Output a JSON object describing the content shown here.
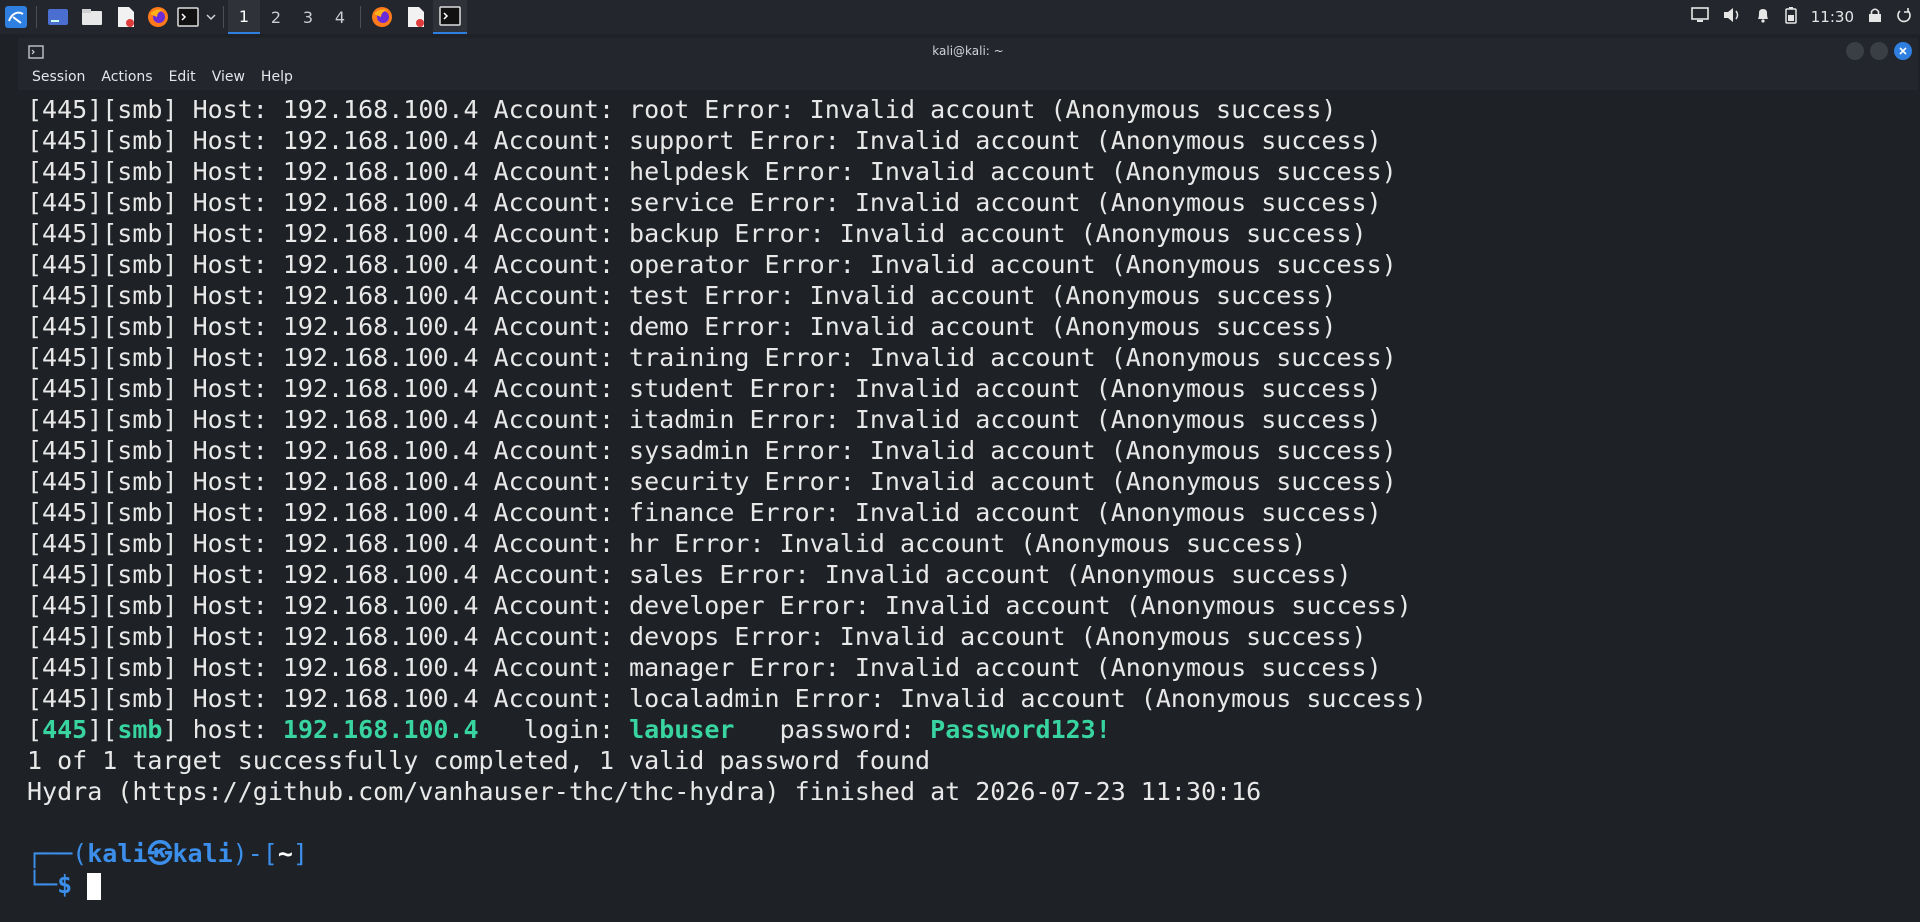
{
  "panel": {
    "workspaces": [
      "1",
      "2",
      "3",
      "4"
    ],
    "active_workspace": "1",
    "clock": "11:30",
    "icons": [
      "kali-menu-icon",
      "desktop-icon",
      "file-manager-icon",
      "text-editor-icon",
      "firefox-icon",
      "terminal-icon",
      "chevron-down-icon",
      "firefox-icon",
      "text-editor-icon",
      "terminal-icon",
      "display-icon",
      "volume-icon",
      "bell-icon",
      "battery-icon",
      "lock-icon",
      "power-icon"
    ]
  },
  "window": {
    "title": "kali@kali: ~",
    "menu": [
      "Session",
      "Actions",
      "Edit",
      "View",
      "Help"
    ]
  },
  "terminal": {
    "account_lines": [
      "[445][smb] Host: 192.168.100.4 Account: root Error: Invalid account (Anonymous success)",
      "[445][smb] Host: 192.168.100.4 Account: support Error: Invalid account (Anonymous success)",
      "[445][smb] Host: 192.168.100.4 Account: helpdesk Error: Invalid account (Anonymous success)",
      "[445][smb] Host: 192.168.100.4 Account: service Error: Invalid account (Anonymous success)",
      "[445][smb] Host: 192.168.100.4 Account: backup Error: Invalid account (Anonymous success)",
      "[445][smb] Host: 192.168.100.4 Account: operator Error: Invalid account (Anonymous success)",
      "[445][smb] Host: 192.168.100.4 Account: test Error: Invalid account (Anonymous success)",
      "[445][smb] Host: 192.168.100.4 Account: demo Error: Invalid account (Anonymous success)",
      "[445][smb] Host: 192.168.100.4 Account: training Error: Invalid account (Anonymous success)",
      "[445][smb] Host: 192.168.100.4 Account: student Error: Invalid account (Anonymous success)",
      "[445][smb] Host: 192.168.100.4 Account: itadmin Error: Invalid account (Anonymous success)",
      "[445][smb] Host: 192.168.100.4 Account: sysadmin Error: Invalid account (Anonymous success)",
      "[445][smb] Host: 192.168.100.4 Account: security Error: Invalid account (Anonymous success)",
      "[445][smb] Host: 192.168.100.4 Account: finance Error: Invalid account (Anonymous success)",
      "[445][smb] Host: 192.168.100.4 Account: hr Error: Invalid account (Anonymous success)",
      "[445][smb] Host: 192.168.100.4 Account: sales Error: Invalid account (Anonymous success)",
      "[445][smb] Host: 192.168.100.4 Account: developer Error: Invalid account (Anonymous success)",
      "[445][smb] Host: 192.168.100.4 Account: devops Error: Invalid account (Anonymous success)",
      "[445][smb] Host: 192.168.100.4 Account: manager Error: Invalid account (Anonymous success)",
      "[445][smb] Host: 192.168.100.4 Account: localadmin Error: Invalid account (Anonymous success)"
    ],
    "success": {
      "port": "445",
      "service": "smb",
      "host_label": "host:",
      "host": "192.168.100.4",
      "login_label": "login:",
      "login": "labuser",
      "password_label": "password:",
      "password": "Password123!"
    },
    "summary": "1 of 1 target successfully completed, 1 valid password found",
    "finished": "Hydra (https://github.com/vanhauser-thc/thc-hydra) finished at 2026-07-23 11:30:16",
    "prompt": {
      "user": "kali",
      "host": "kali",
      "dir": "~",
      "symbol": "$"
    }
  },
  "colors": {
    "accent": "#2f7fe0",
    "success_green": "#39d5a0",
    "prompt_blue": "#3b8eea",
    "background": "#1e2126"
  }
}
